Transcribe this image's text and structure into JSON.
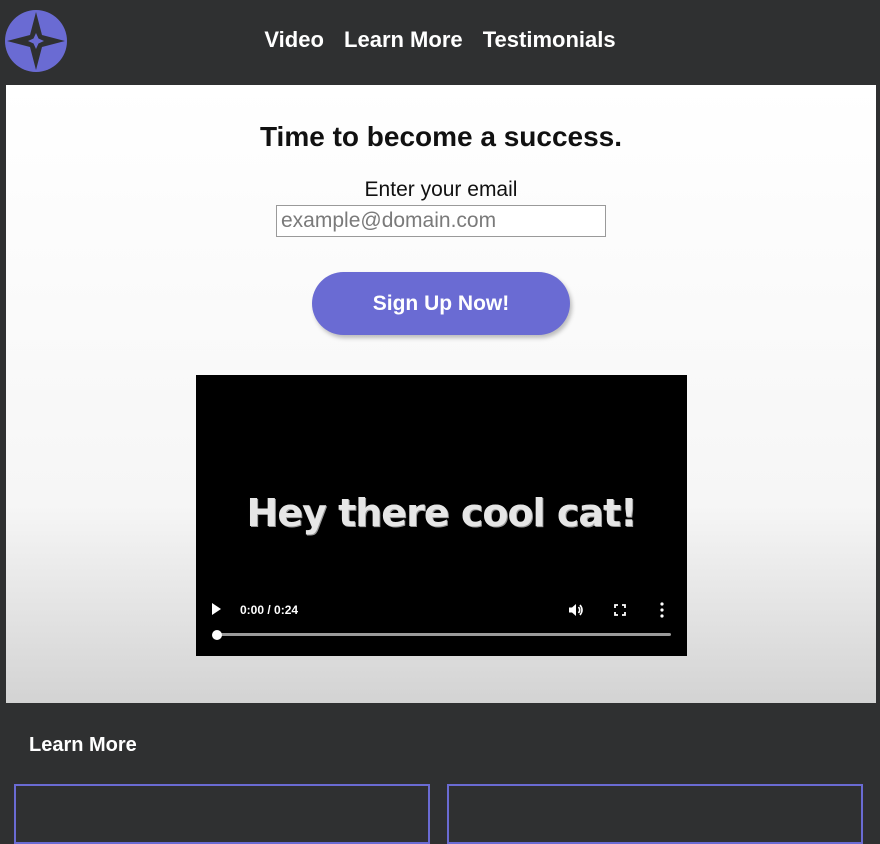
{
  "nav": {
    "logo_icon": "compass-star-icon",
    "links": [
      {
        "label": "Video"
      },
      {
        "label": "Learn More"
      },
      {
        "label": "Testimonials"
      }
    ]
  },
  "hero": {
    "headline": "Time to become a success.",
    "email_label": "Enter your email",
    "email_placeholder": "example@domain.com",
    "email_value": "",
    "signup_label": "Sign Up Now!"
  },
  "video": {
    "caption": "Hey there cool cat!",
    "time": "0:00 / 0:24",
    "progress_fraction": 0,
    "controls": {
      "play_icon": "play-icon",
      "volume_icon": "volume-icon",
      "fullscreen_icon": "fullscreen-icon",
      "more_icon": "more-vertical-icon"
    }
  },
  "learn_more": {
    "title": "Learn More"
  },
  "colors": {
    "accent": "#6a6bd3",
    "background_dark": "#2f3031",
    "hero_bg": "#ffffff"
  }
}
